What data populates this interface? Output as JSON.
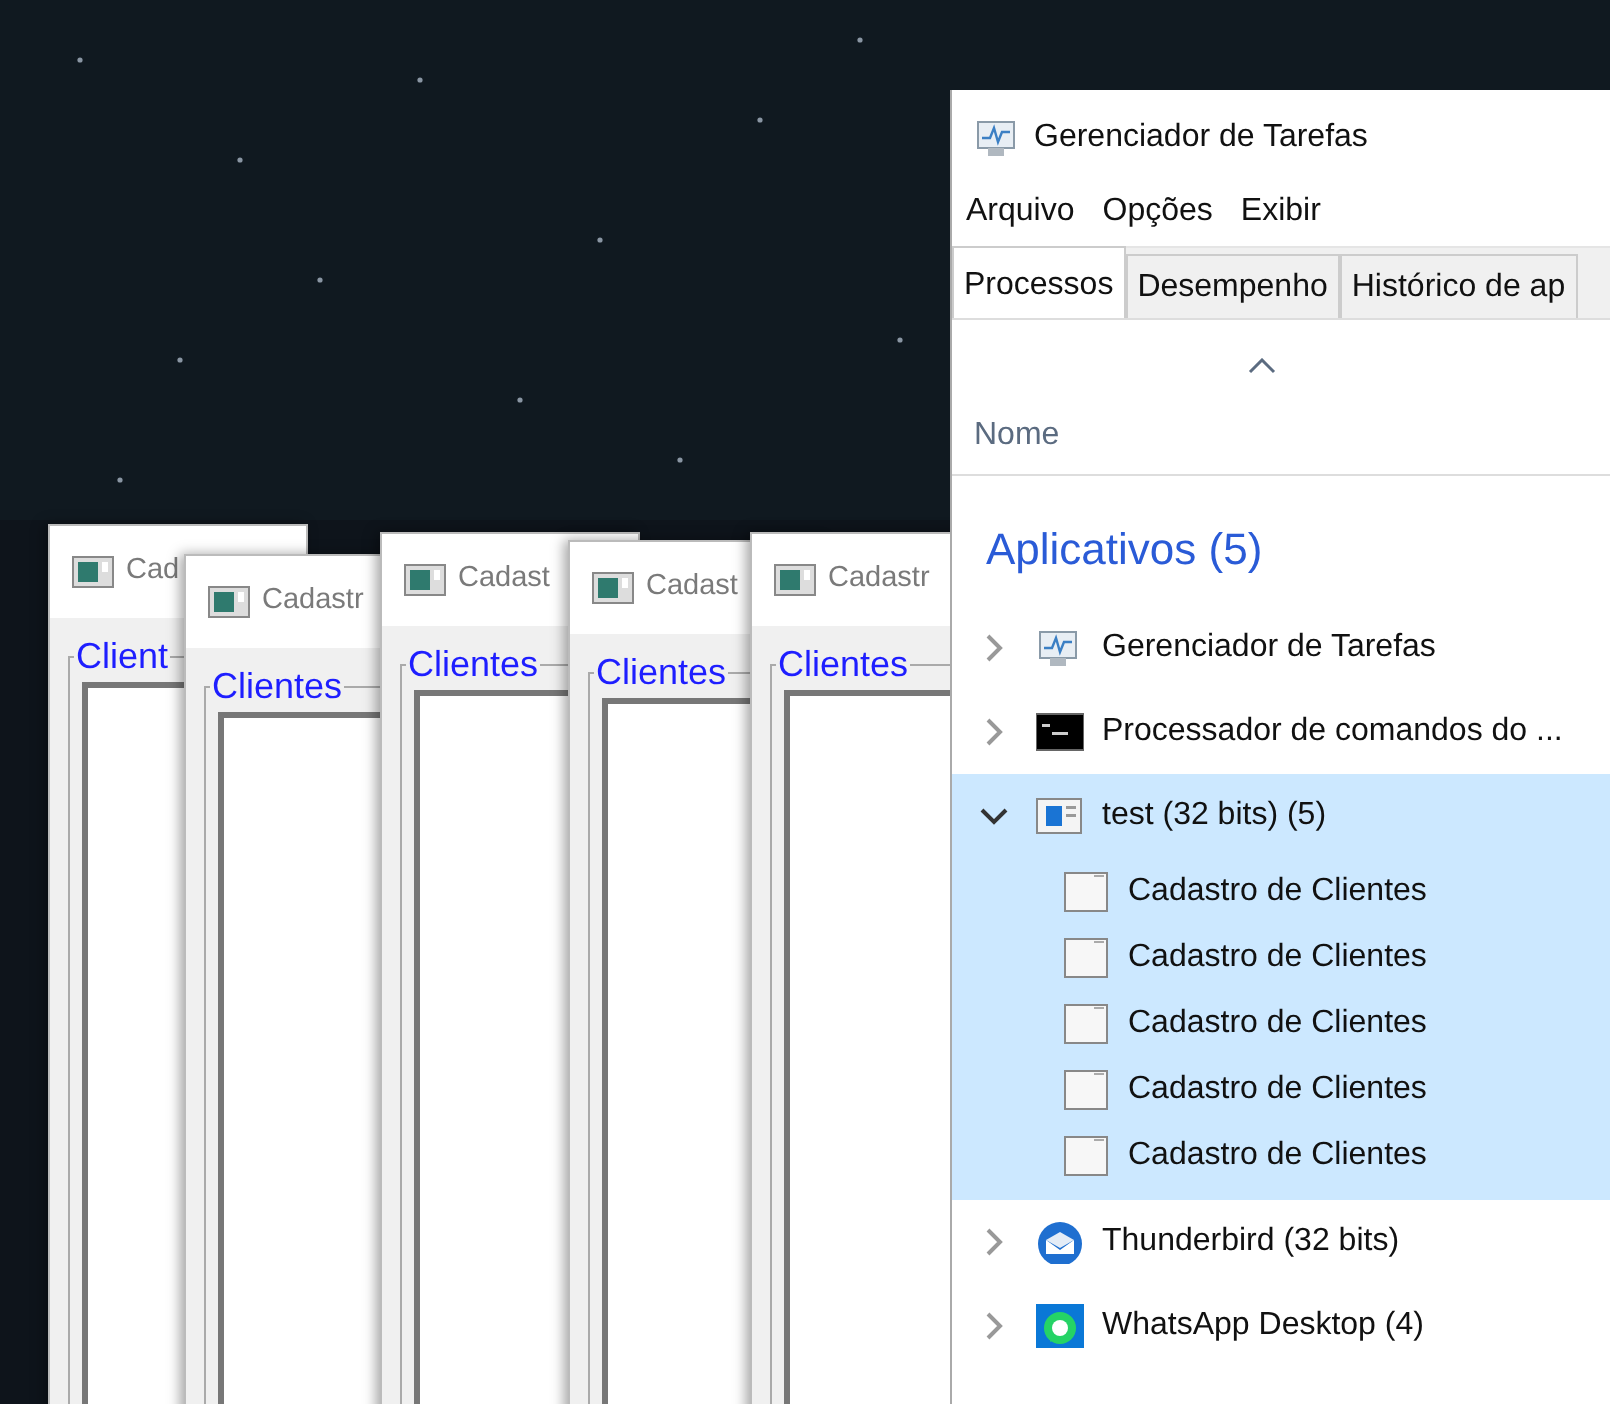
{
  "windows": [
    {
      "title": "Cad",
      "group_label": "Client"
    },
    {
      "title": "Cadastr",
      "group_label": "Clientes"
    },
    {
      "title": "Cadast",
      "group_label": "Clientes"
    },
    {
      "title": "Cadast",
      "group_label": "Clientes"
    },
    {
      "title": "Cadastr",
      "group_label": "Clientes"
    }
  ],
  "task_manager": {
    "title": "Gerenciador de Tarefas",
    "menu": [
      "Arquivo",
      "Opções",
      "Exibir"
    ],
    "tabs": [
      {
        "label": "Processos",
        "selected": true
      },
      {
        "label": "Desempenho",
        "selected": false
      },
      {
        "label": "Histórico de ap",
        "selected": false
      }
    ],
    "column_header": "Nome",
    "group": {
      "label": "Aplicativos (5)",
      "items": [
        {
          "name": "Gerenciador de Tarefas",
          "kind": "monitor",
          "expanded": false,
          "selected": false
        },
        {
          "name": "Processador de comandos do ...",
          "kind": "console",
          "expanded": false,
          "selected": false
        },
        {
          "name": "test (32 bits) (5)",
          "kind": "app",
          "expanded": true,
          "selected": true,
          "children": [
            {
              "name": "Cadastro de Clientes"
            },
            {
              "name": "Cadastro de Clientes"
            },
            {
              "name": "Cadastro de Clientes"
            },
            {
              "name": "Cadastro de Clientes"
            },
            {
              "name": "Cadastro de Clientes"
            }
          ]
        },
        {
          "name": "Thunderbird (32 bits)",
          "kind": "mail",
          "expanded": false,
          "selected": false
        },
        {
          "name": "WhatsApp Desktop (4)",
          "kind": "chat",
          "expanded": false,
          "selected": false
        }
      ]
    }
  }
}
